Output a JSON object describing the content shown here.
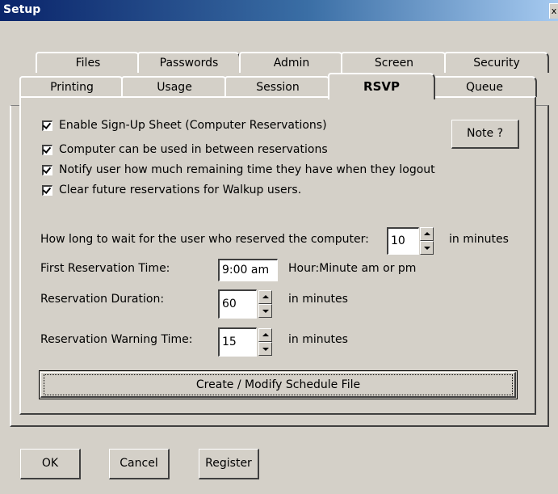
{
  "window": {
    "title": "Setup",
    "close_glyph": "x"
  },
  "tabs_back": [
    "Files",
    "Passwords",
    "Admin",
    "Screen",
    "Security"
  ],
  "tabs_front": [
    "Printing",
    "Usage",
    "Session",
    "RSVP",
    "Queue"
  ],
  "active_tab": "RSVP",
  "checkboxes": [
    {
      "label": "Enable Sign-Up Sheet (Computer Reservations)",
      "checked": true
    },
    {
      "label": "Computer can be used in between reservations",
      "checked": true
    },
    {
      "label": "Notify user how much remaining time they have when they logout",
      "checked": true
    },
    {
      "label": "Clear future reservations for Walkup users.",
      "checked": true
    }
  ],
  "note_button": "Note ?",
  "wait": {
    "label": "How long to wait for the user who reserved the computer:",
    "value": "10",
    "unit": "in minutes"
  },
  "first_time": {
    "label": "First Reservation Time:",
    "value": "9:00 am",
    "hint": "Hour:Minute am or pm"
  },
  "duration": {
    "label": "Reservation Duration:",
    "value": "60",
    "unit": "in minutes"
  },
  "warning": {
    "label": "Reservation Warning Time:",
    "value": "15",
    "unit": "in minutes"
  },
  "schedule_button": "Create / Modify Schedule File",
  "footer_buttons": {
    "ok": "OK",
    "cancel": "Cancel",
    "register": "Register"
  },
  "icons": [
    "checkmark-icon",
    "spin-up-icon",
    "spin-down-icon",
    "close-icon"
  ]
}
